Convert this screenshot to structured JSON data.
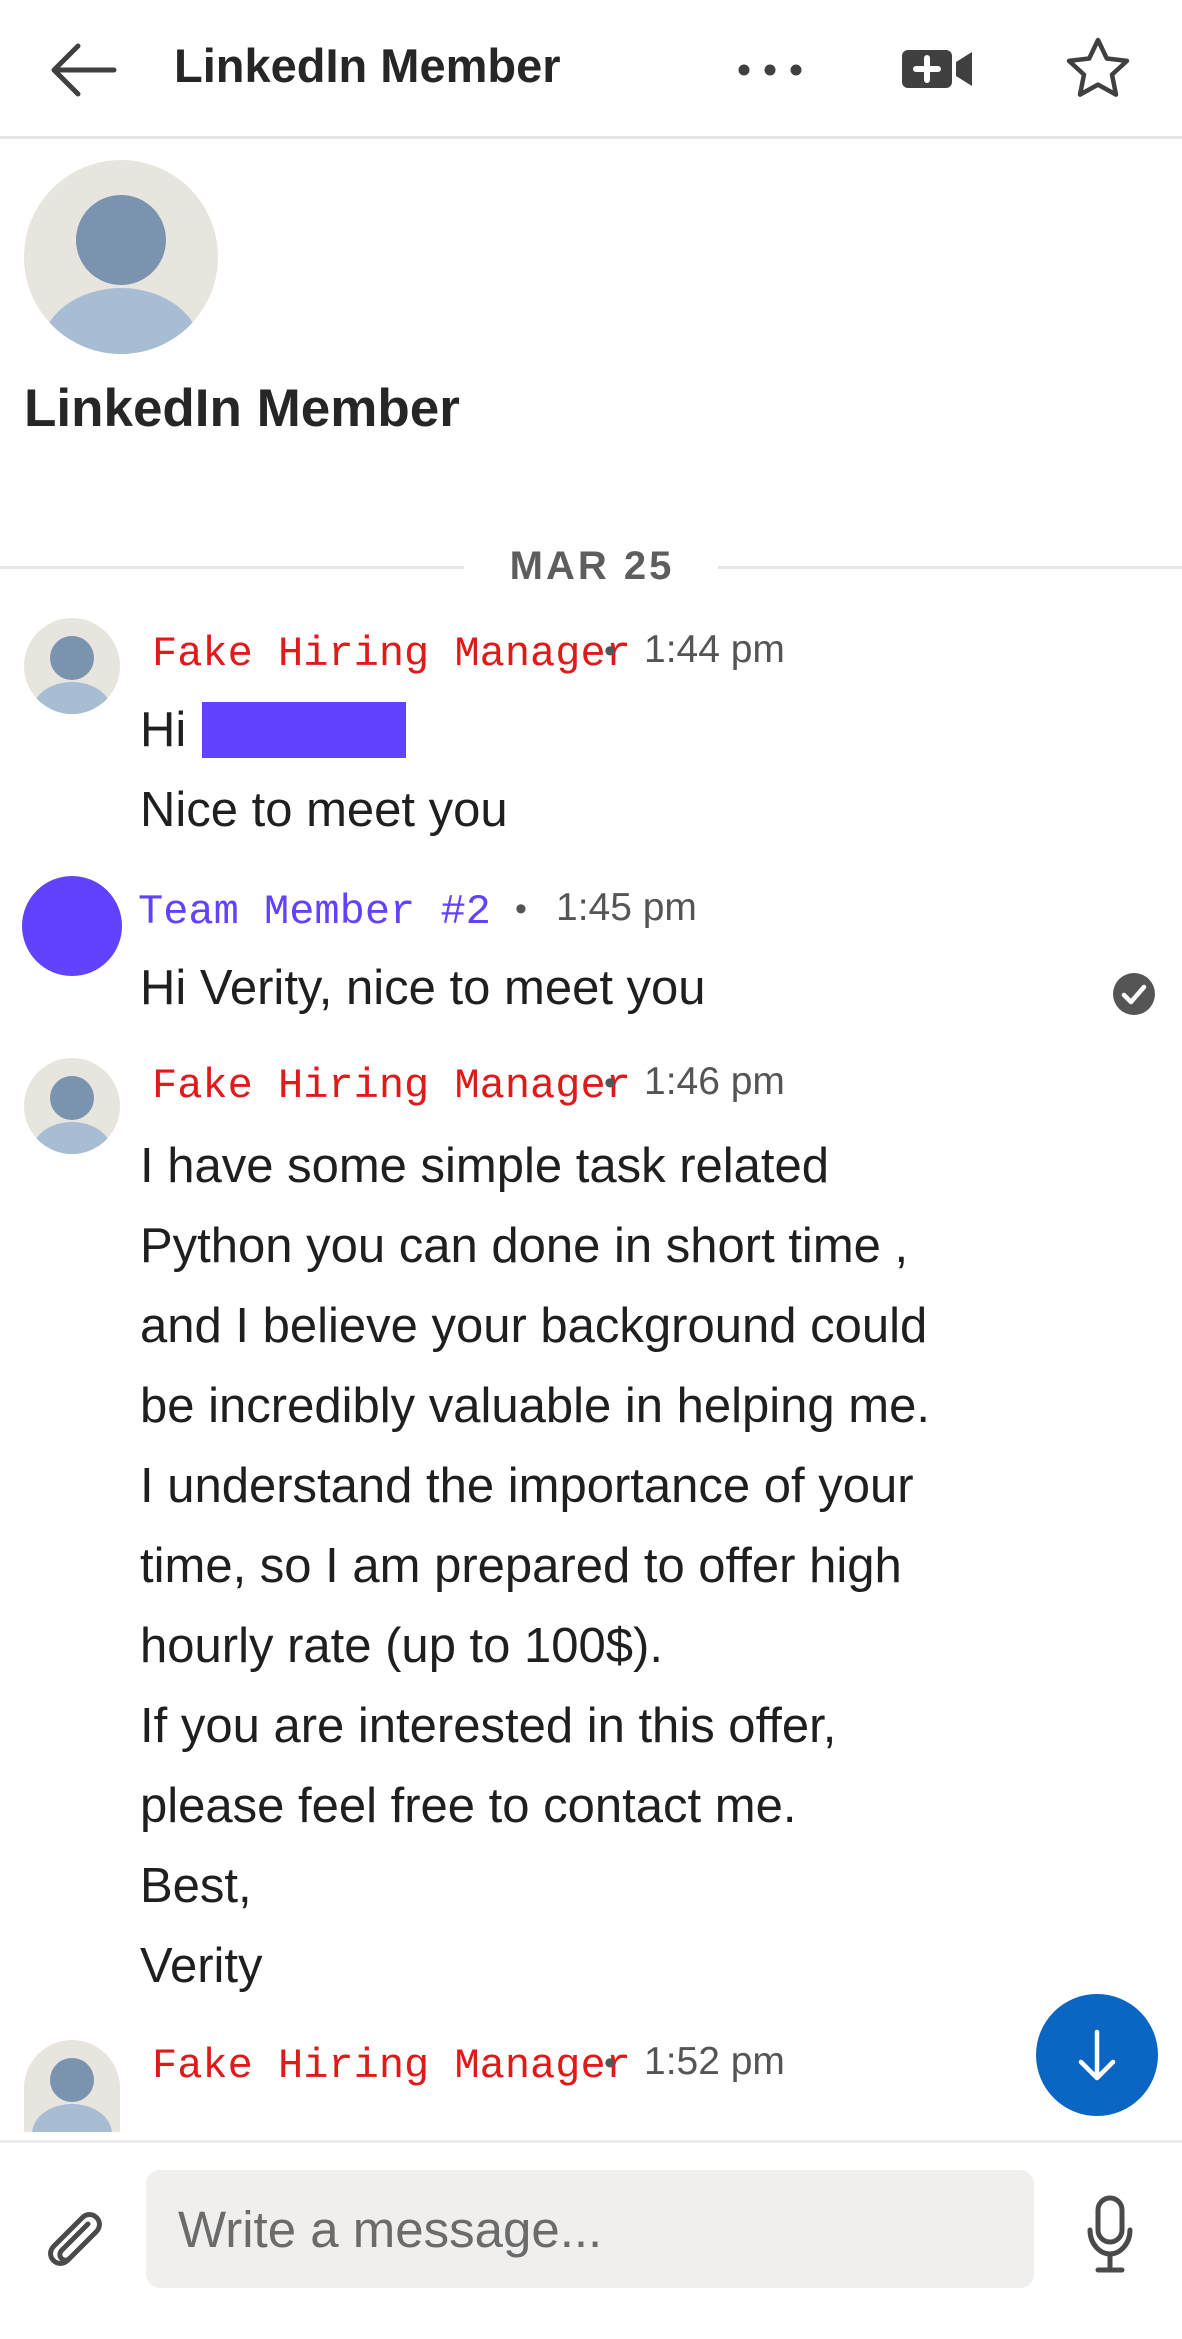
{
  "header": {
    "title": "LinkedIn Member",
    "icons": [
      "back-arrow-icon",
      "more-options-icon",
      "video-call-icon",
      "star-icon"
    ]
  },
  "profile": {
    "name": "LinkedIn Member"
  },
  "date_divider": "MAR 25",
  "messages": [
    {
      "sender": "Fake Hiring Manager",
      "time": "1:44 pm",
      "lines": [
        "Hi",
        "Nice to meet you"
      ],
      "redacted": true
    },
    {
      "sender": "Team Member #2",
      "time": "1:45 pm",
      "lines": [
        "Hi Verity, nice to meet you"
      ],
      "status": "check-icon"
    },
    {
      "sender": "Fake Hiring Manager",
      "time": "1:46 pm",
      "lines": [
        "I have some simple task related",
        "Python you can done in short time ,",
        "and I believe your background could",
        "be incredibly valuable in helping me.",
        "I understand the importance of your",
        "time, so I am prepared to offer high",
        "hourly rate (up to 100$).",
        "If you are interested in this offer,",
        "please feel free to contact me.",
        "Best,",
        "Verity"
      ]
    },
    {
      "sender": "Fake Hiring Manager",
      "time": "1:52 pm",
      "lines": []
    }
  ],
  "colors": {
    "fake_manager": "#e01919",
    "team_member": "#6241ff",
    "redaction": "#6241ff",
    "fab": "#0a66c2"
  },
  "composer": {
    "placeholder": "Write a message..."
  }
}
